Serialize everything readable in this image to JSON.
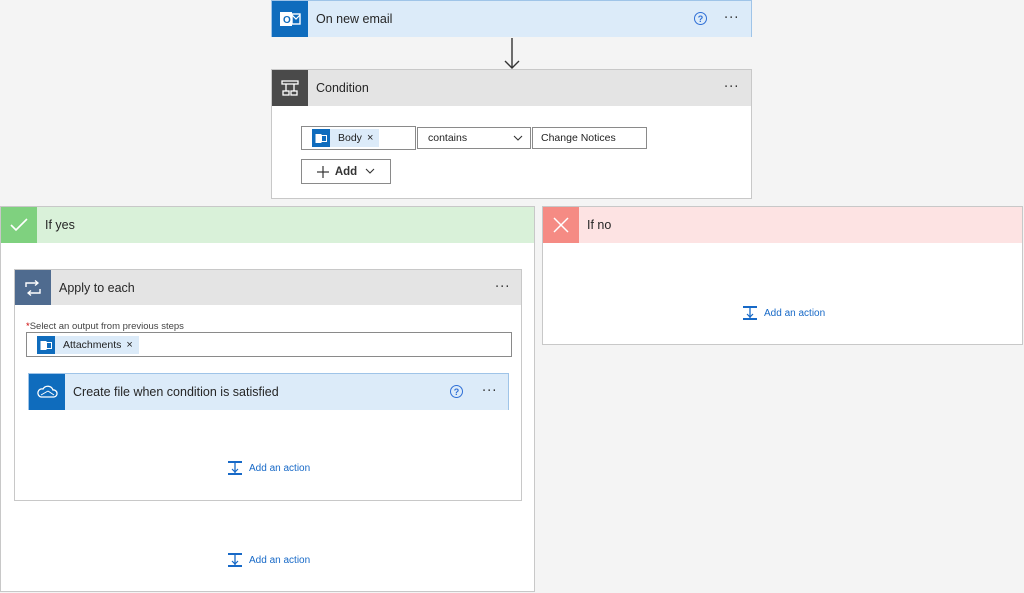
{
  "trigger": {
    "title": "On new email",
    "icon": "outlook-icon",
    "more": "···"
  },
  "condition": {
    "title": "Condition",
    "more": "···",
    "operand": {
      "token": "Body",
      "remove": "×"
    },
    "operator": "contains",
    "value": "Change Notices",
    "add_label": "Add"
  },
  "if_yes": {
    "title": "If yes",
    "color": "#d9f1d9",
    "apply_each": {
      "title": "Apply to each",
      "more": "···",
      "required_mark": "*",
      "field_label": "Select an output from previous steps",
      "token": "Attachments",
      "token_remove": "×",
      "action": {
        "title": "Create file when condition is satisfied",
        "icon": "onedrive-icon",
        "more": "···"
      },
      "add_action": "Add an action"
    },
    "add_action": "Add an action"
  },
  "if_no": {
    "title": "If no",
    "color": "#fde3e3",
    "add_action": "Add an action"
  },
  "colors": {
    "accent": "#0f6cbd",
    "link": "#1769c7",
    "condition_header": "#4a4a4a",
    "apply_header": "#4f6b8f"
  }
}
